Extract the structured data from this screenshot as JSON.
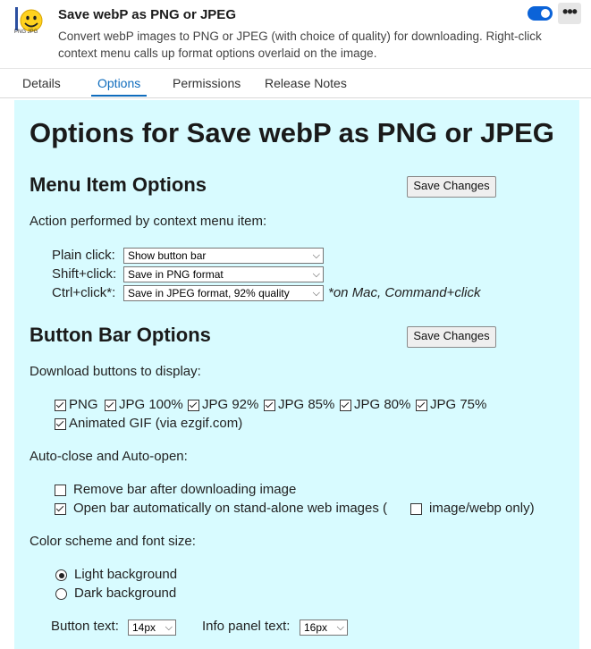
{
  "extension": {
    "icon_label": "PNG JPG",
    "title": "Save webP as PNG or JPEG",
    "description": "Convert webP images to PNG or JPEG (with choice of quality) for downloading. Right-click context menu calls up format options overlaid on the image.",
    "enabled": true,
    "more_label": "•••"
  },
  "tabs": [
    {
      "label": "Details",
      "active": false
    },
    {
      "label": "Options",
      "active": true
    },
    {
      "label": "Permissions",
      "active": false
    },
    {
      "label": "Release Notes",
      "active": false
    }
  ],
  "options": {
    "page_title": "Options for Save webP as PNG or JPEG",
    "menu_section": {
      "heading": "Menu Item Options",
      "save_label": "Save Changes",
      "action_label": "Action performed by context menu item:",
      "rows": [
        {
          "label": "Plain click:",
          "value": "Show button bar"
        },
        {
          "label": "Shift+click:",
          "value": "Save in PNG format"
        },
        {
          "label": "Ctrl+click*:",
          "value": "Save in JPEG format, 92% quality"
        }
      ],
      "mac_note": "*on Mac, Command+click"
    },
    "bar_section": {
      "heading": "Button Bar Options",
      "save_label": "Save Changes",
      "download_label": "Download buttons to display:",
      "buttons": [
        {
          "label": "PNG",
          "checked": true
        },
        {
          "label": "JPG 100%",
          "checked": true
        },
        {
          "label": "JPG 92%",
          "checked": true
        },
        {
          "label": "JPG 85%",
          "checked": true
        },
        {
          "label": "JPG 80%",
          "checked": true
        },
        {
          "label": "JPG 75%",
          "checked": true
        },
        {
          "label": "Animated GIF (via ezgif.com)",
          "checked": true
        }
      ],
      "auto_label": "Auto-close and Auto-open:",
      "remove_bar": {
        "label": "Remove bar after downloading image",
        "checked": false
      },
      "open_bar": {
        "label": "Open bar automatically on stand-alone web images (",
        "checked": true
      },
      "webp_only": {
        "label": "image/webp only)",
        "checked": false
      },
      "color_label": "Color scheme and font size:",
      "light": {
        "label": "Light background",
        "selected": true
      },
      "dark": {
        "label": "Dark background",
        "selected": false
      },
      "button_text_label": "Button text:",
      "button_text_value": "14px",
      "info_text_label": "Info panel text:",
      "info_text_value": "16px"
    }
  },
  "colors": {
    "panel_bg": "#d8fbff",
    "accent": "#0f6cbd",
    "toggle_on": "#0b63d8"
  }
}
